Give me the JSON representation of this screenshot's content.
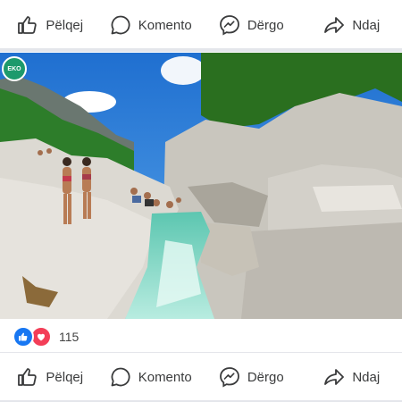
{
  "top_actions": [
    {
      "label": "Pëlqej",
      "icon": "thumbs-up-icon"
    },
    {
      "label": "Komento",
      "icon": "comment-bubble-icon"
    },
    {
      "label": "Dërgo",
      "icon": "messenger-icon"
    },
    {
      "label": "Ndaj",
      "icon": "share-arrow-icon"
    }
  ],
  "photo": {
    "badge_text": "EKO",
    "description_colors": {
      "sky": "#2a7ad8",
      "rock": "#d9d6cf",
      "water": "#7fd6c4",
      "foliage": "#2f7a26"
    }
  },
  "reactions": {
    "icons": [
      "like-icon",
      "love-icon"
    ],
    "count": "115",
    "colors": {
      "like": "#1877f2",
      "love": "#f33e58"
    }
  },
  "bottom_actions": [
    {
      "label": "Pëlqej",
      "icon": "thumbs-up-icon"
    },
    {
      "label": "Komento",
      "icon": "comment-bubble-icon"
    },
    {
      "label": "Dërgo",
      "icon": "messenger-icon"
    },
    {
      "label": "Ndaj",
      "icon": "share-arrow-icon"
    }
  ]
}
